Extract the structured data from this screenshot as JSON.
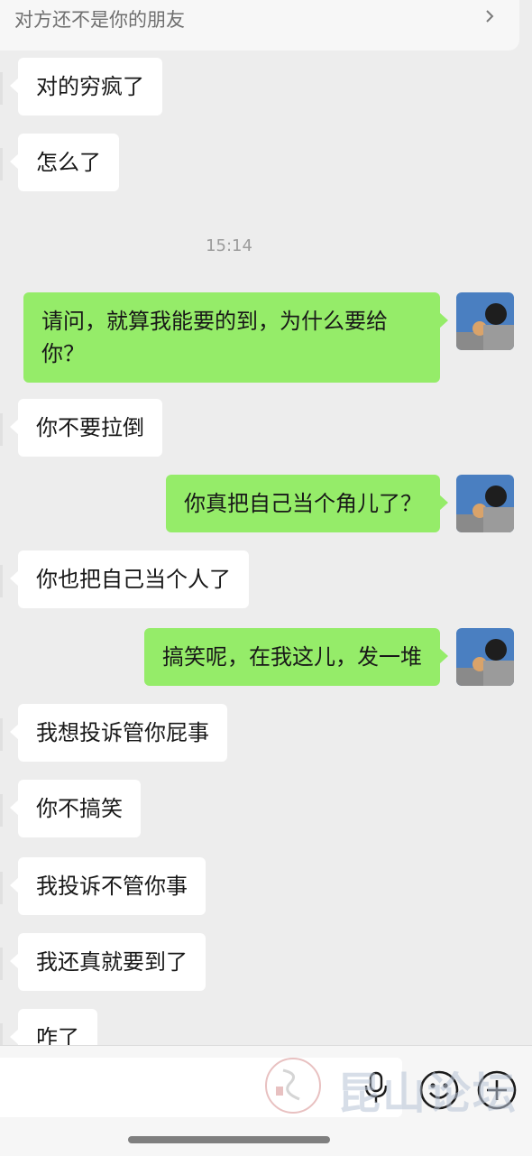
{
  "notice": {
    "text": "对方还不是你的朋友"
  },
  "time": "15:14",
  "messages": {
    "m1": "对的穷疯了",
    "m2": "怎么了",
    "m3": "请问，就算我能要的到，为什么要给你？",
    "m4": "你不要拉倒",
    "m5": "你真把自己当个角儿了？",
    "m6": "你也把自己当个人了",
    "m7": "搞笑呢，在我这儿，发一堆",
    "m8": "我想投诉管你屁事",
    "m9": "你不搞笑",
    "m10": "我投诉不管你事",
    "m11": "我还真就要到了",
    "m12": "咋了"
  },
  "input": {
    "value": ""
  },
  "watermark": {
    "text": "昆山论坛"
  },
  "colors": {
    "outgoing": "#95ec69",
    "incoming": "#ffffff",
    "background": "#ededed"
  },
  "icons": [
    "chevron-right-icon",
    "microphone-icon",
    "emoji-icon",
    "plus-icon"
  ]
}
